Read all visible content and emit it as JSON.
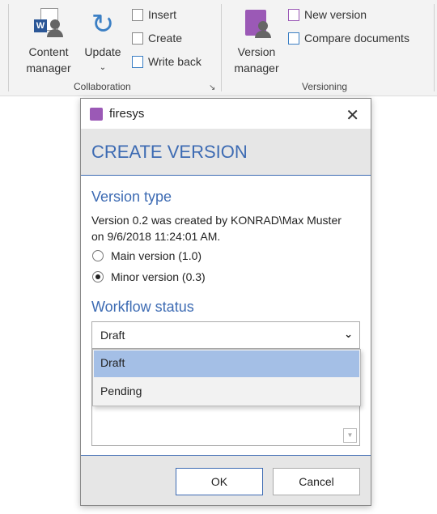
{
  "ribbon": {
    "collaboration": {
      "label": "Collaboration",
      "content_manager": "Content manager",
      "update": "Update",
      "insert": "Insert",
      "create": "Create",
      "write_back": "Write back"
    },
    "versioning": {
      "label": "Versioning",
      "version_manager": "Version manager",
      "new_version": "New version",
      "compare_documents": "Compare documents"
    }
  },
  "dialog": {
    "app_title": "firesys",
    "heading": "CREATE VERSION",
    "version_type": {
      "label": "Version type",
      "info_line1": "Version 0.2 was created by KONRAD\\Max Muster",
      "info_line2": "on 9/6/2018 11:24:01 AM.",
      "options": [
        {
          "label": "Main version (1.0)",
          "selected": false
        },
        {
          "label": "Minor version (0.3)",
          "selected": true
        }
      ]
    },
    "workflow_status": {
      "label": "Workflow status",
      "value": "Draft",
      "options": [
        "Draft",
        "Pending"
      ],
      "highlighted": "Draft"
    },
    "ok": "OK",
    "cancel": "Cancel"
  },
  "colors": {
    "accent": "#3d6bb3",
    "highlight": "#a4bfe6",
    "brand_purple": "#9b59b6"
  }
}
